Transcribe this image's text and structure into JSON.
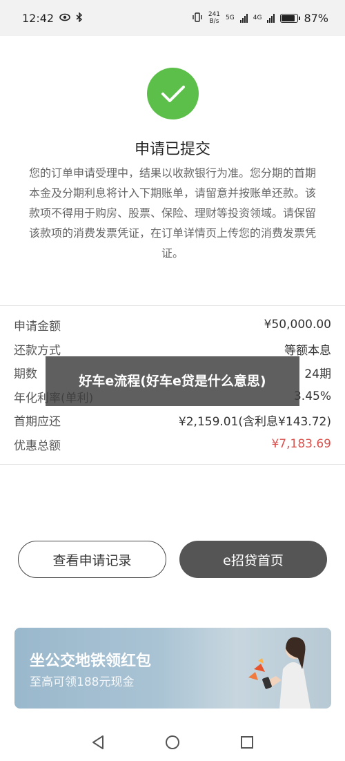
{
  "status_bar": {
    "time": "12:42",
    "net_speed_value": "241",
    "net_speed_unit": "B/s",
    "signal_tag1": "5G",
    "signal_tag2": "4G",
    "battery_percent": "87%"
  },
  "result": {
    "title": "申请已提交",
    "description": "您的订单申请受理中，结果以收款银行为准。您分期的首期本金及分期利息将计入下期账单，请留意并按账单还款。该款项不得用于购房、股票、保险、理财等投资领域。请保留该款项的消费发票凭证，在订单详情页上传您的消费发票凭证。"
  },
  "details": [
    {
      "label": "申请金额",
      "value": "¥50,000.00"
    },
    {
      "label": "还款方式",
      "value": "等额本息"
    },
    {
      "label": "期数",
      "value": "24期"
    },
    {
      "label": "年化利率(单利)",
      "value": "3.45%"
    },
    {
      "label": "首期应还",
      "value": "¥2,159.01(含利息¥143.72)"
    },
    {
      "label": "优惠总额",
      "value": "¥7,183.69"
    }
  ],
  "overlay_text": "好车e流程(好车e贷是什么意思)",
  "buttons": {
    "view_records": "查看申请记录",
    "home": "e招贷首页"
  },
  "banner": {
    "title": "坐公交地铁领红包",
    "subtitle": "至高可领188元现金"
  },
  "colors": {
    "success_green": "#5bbf4a",
    "discount_red": "#d9534f",
    "primary_button": "#555555"
  }
}
